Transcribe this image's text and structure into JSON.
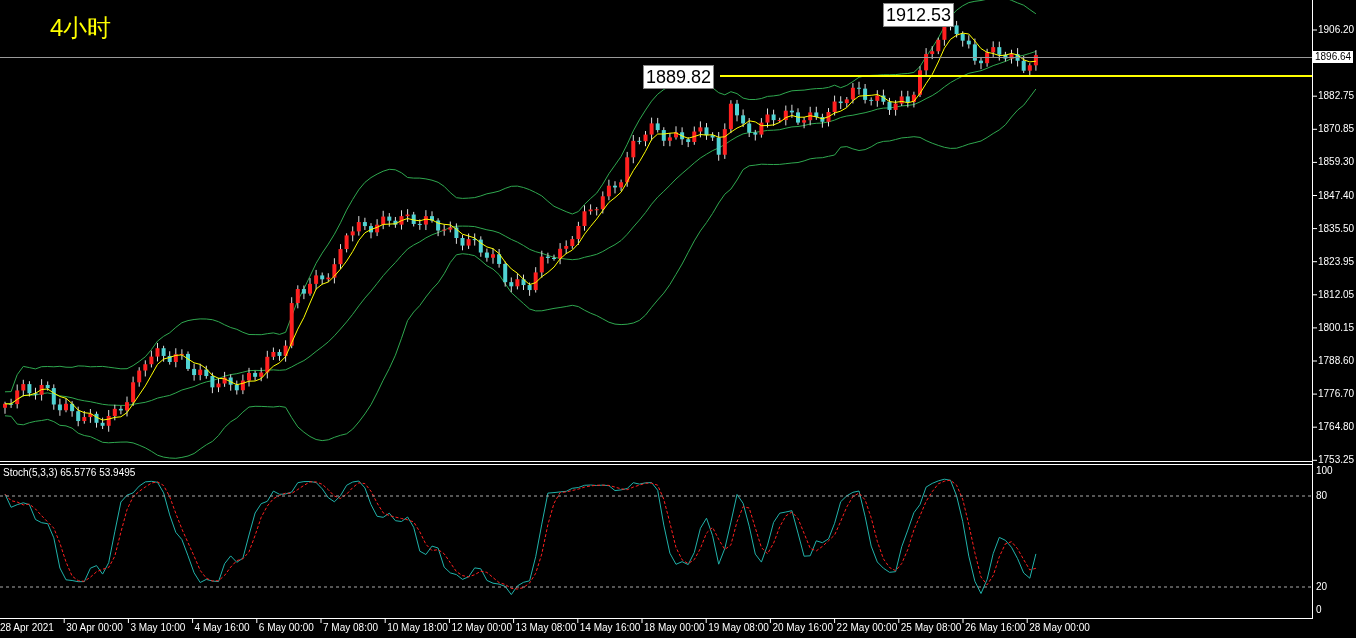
{
  "chart": {
    "title": "4小时",
    "current_price": "1896.64",
    "price_tags": [
      {
        "kind": "high",
        "text": "1912.53"
      },
      {
        "kind": "level",
        "text": "1889.82"
      }
    ]
  },
  "price_axis": [
    "1906.20",
    "1882.75",
    "1870.85",
    "1859.30",
    "1847.40",
    "1835.50",
    "1823.95",
    "1812.05",
    "1800.15",
    "1788.60",
    "1776.70",
    "1764.80",
    "1753.25"
  ],
  "indicator": {
    "label": "Stoch(5,3,3) 65.5776 53.9495",
    "levels": [
      "100",
      "80",
      "20",
      "0"
    ]
  },
  "time_axis": [
    "28 Apr 2021",
    "30 Apr 00:00",
    "3 May 10:00",
    "4 May 16:00",
    "6 May 00:00",
    "7 May 08:00",
    "10 May 18:00",
    "12 May 00:00",
    "13 May 08:00",
    "14 May 16:00",
    "18 May 00:00",
    "19 May 08:00",
    "20 May 16:00",
    "22 May 00:00",
    "25 May 08:00",
    "26 May 16:00",
    "28 May 00:00"
  ]
}
